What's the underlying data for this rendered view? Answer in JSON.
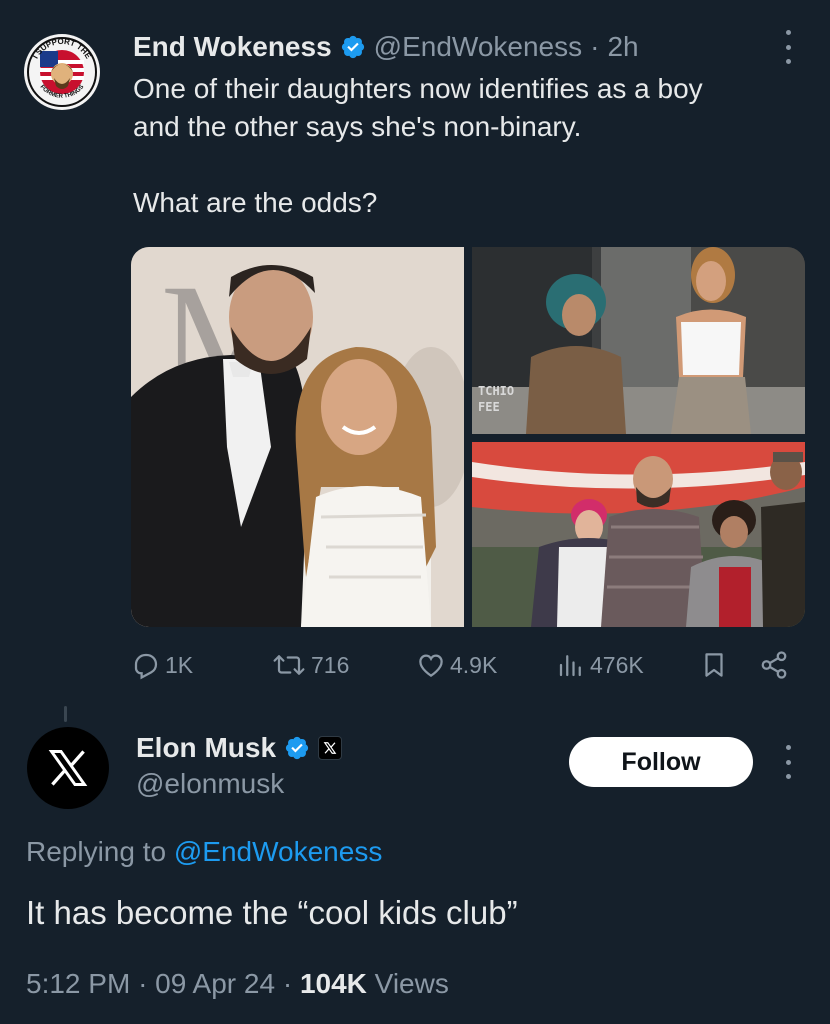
{
  "post": {
    "author": {
      "display_name": "End Wokeness",
      "handle": "@EndWokeness",
      "time": "2h",
      "verified": true,
      "avatar_icon": "support-former-things-badge-icon",
      "avatar_text_top": "I SUPPORT THE",
      "avatar_text_bottom": "FORMER THINGS"
    },
    "text_line1": "One of their daughters now identifies as a boy",
    "text_line2": "and the other says she's non-binary.",
    "text_line3": "What are the odds?",
    "media": {
      "images": [
        "couple-red-carpet-photo",
        "teen-and-woman-street-photo",
        "group-walking-street-photo"
      ],
      "sign_text_1": "TCHIO",
      "sign_text_2": "FEE"
    },
    "stats": {
      "replies": "1K",
      "reposts": "716",
      "likes": "4.9K",
      "views": "476K"
    }
  },
  "reply": {
    "author": {
      "display_name": "Elon Musk",
      "handle": "@elonmusk",
      "verified": true,
      "affiliate_icon": "x-logo-icon"
    },
    "follow_label": "Follow",
    "replying_prefix": "Replying to",
    "replying_mention": "@EndWokeness",
    "text": "It has become the “cool kids club”",
    "time": "5:12 PM",
    "date": "09 Apr 24",
    "views_count": "104K",
    "views_label": "Views"
  },
  "colors": {
    "background": "#15202b",
    "accent": "#1d9bf0",
    "muted": "#8b98a5",
    "text": "#e7e9ea"
  }
}
